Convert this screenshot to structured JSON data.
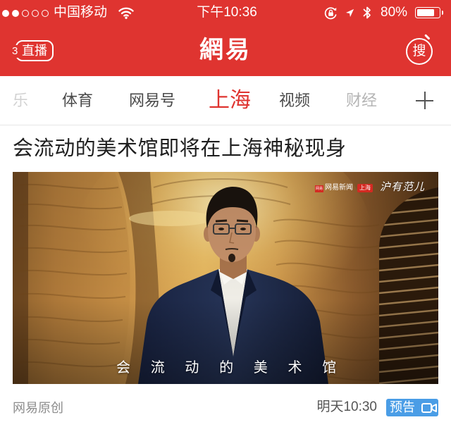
{
  "status_bar": {
    "signal_strength": 2,
    "signal_max": 5,
    "carrier": "中国移动",
    "time": "下午10:36",
    "battery": "80%",
    "icons": [
      "wifi-icon",
      "rotation-lock-icon",
      "location-icon",
      "bluetooth-icon",
      "battery-icon"
    ]
  },
  "header": {
    "live_badge_count": "3",
    "live_label": "直播",
    "logo": "網易",
    "search_label": "搜"
  },
  "tabs": [
    {
      "label": "乐"
    },
    {
      "label": "体育"
    },
    {
      "label": "网易号"
    },
    {
      "label": "上海",
      "active": true
    },
    {
      "label": "视频"
    },
    {
      "label": "财经"
    }
  ],
  "add_tab_icon": "plus-icon",
  "article": {
    "title": "会流动的美术馆即将在上海神秘现身",
    "image": {
      "brand_badge": "网易",
      "brand_name": "网易新闻",
      "region_badge": "上海",
      "program_logo": "沪有范儿",
      "caption": "会流动的美术馆"
    },
    "source": "网易原创",
    "publish_time": "明天10:30",
    "badge": {
      "label": "预告",
      "icon": "video-camera-icon"
    }
  },
  "colors": {
    "brand_red": "#df3430",
    "badge_blue": "#4a9de6",
    "text_primary": "#1f1f1f",
    "text_secondary": "#8c8c8c"
  }
}
